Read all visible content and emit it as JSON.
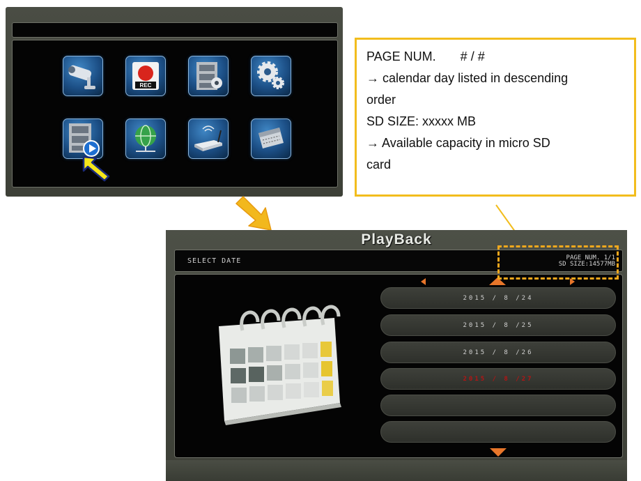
{
  "menu": {
    "icons": [
      {
        "name": "camera-icon",
        "row": 1,
        "col": 1
      },
      {
        "name": "record-icon",
        "row": 1,
        "col": 2,
        "label": "REC"
      },
      {
        "name": "video-settings-icon",
        "row": 1,
        "col": 3
      },
      {
        "name": "gears-icon",
        "row": 1,
        "col": 4
      },
      {
        "name": "playback-icon",
        "row": 2,
        "col": 1,
        "selected": true
      },
      {
        "name": "network-globe-icon",
        "row": 2,
        "col": 2
      },
      {
        "name": "wifi-router-icon",
        "row": 2,
        "col": 3
      },
      {
        "name": "sd-card-icon",
        "row": 2,
        "col": 4
      }
    ]
  },
  "annotation": {
    "lines": [
      "PAGE NUM.       # / #",
      "→ calendar day listed in descending",
      "order",
      "SD SIZE: xxxxx MB",
      "→ Available capacity in micro SD",
      "card"
    ]
  },
  "playback": {
    "title": "PlayBack",
    "select_label": "SELECT DATE",
    "page_num": "PAGE NUM.  1/1",
    "sd_size": "SD SIZE:14577MB",
    "dates": [
      {
        "label": "2015 / 8 /24",
        "selected": false
      },
      {
        "label": "2015 / 8 /25",
        "selected": false
      },
      {
        "label": "2015 / 8 /26",
        "selected": false
      },
      {
        "label": "2015 / 8 /27",
        "selected": true
      },
      {
        "label": "",
        "selected": false
      },
      {
        "label": "",
        "selected": false
      }
    ]
  },
  "colors": {
    "highlight_yellow": "#f2bd1d",
    "dashed_orange": "#f2a81d",
    "nav_orange": "#e8762a",
    "selected_red": "#b31515"
  }
}
